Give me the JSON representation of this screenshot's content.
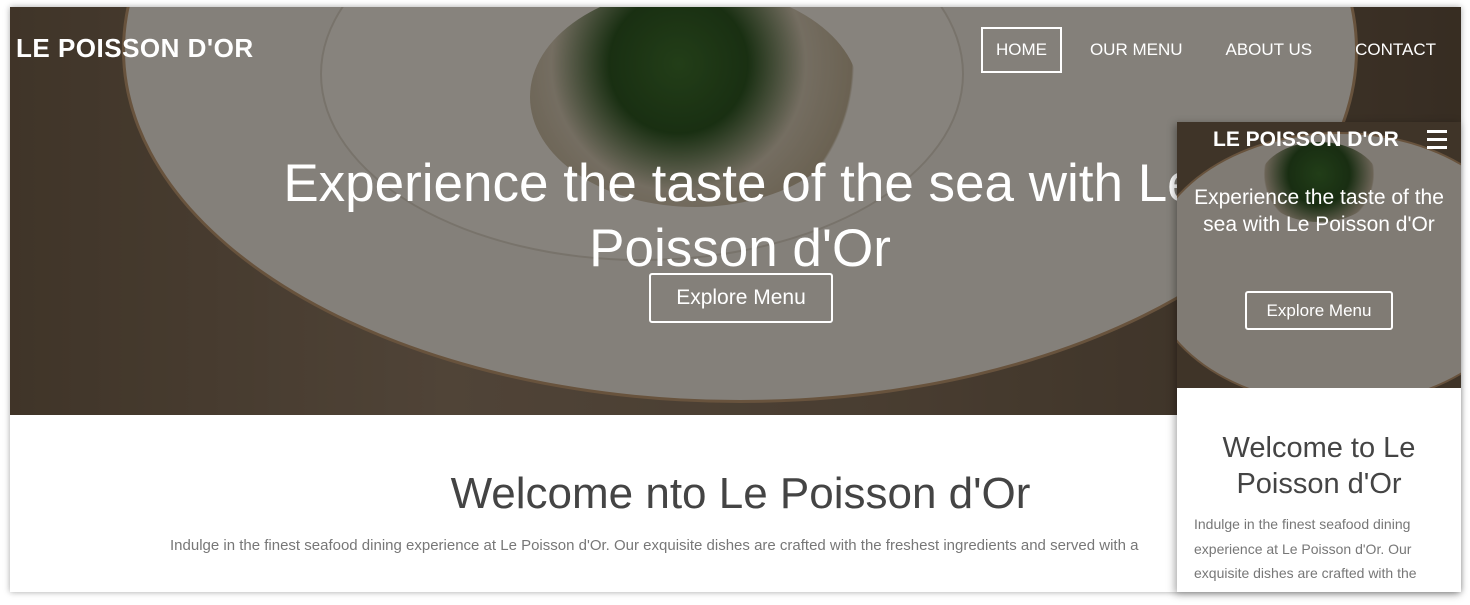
{
  "desktop": {
    "brand": "LE POISSON D'OR",
    "nav": {
      "home": "HOME",
      "menu": "OUR MENU",
      "about": "ABOUT US",
      "contact": "CONTACT"
    },
    "hero": {
      "title": "Experience the taste of the sea with Le Poisson d'Or",
      "button": "Explore Menu"
    },
    "welcome": {
      "title": "Welcome nto Le Poisson d'Or",
      "text": "Indulge in the finest seafood dining experience at Le Poisson d'Or. Our exquisite dishes are crafted with the freshest ingredients and served with a"
    }
  },
  "mobile": {
    "brand": "LE POISSON D'OR",
    "menu_icon": "hamburger-icon",
    "hero": {
      "title": "Experience the taste of the sea with Le Poisson d'Or",
      "button": "Explore Menu"
    },
    "welcome": {
      "title": "Welcome to Le Poisson d'Or",
      "text": "Indulge in the finest seafood dining experience at Le Poisson d'Or. Our exquisite dishes are crafted with the"
    }
  },
  "colors": {
    "overlay": "#000000",
    "heading_text": "#444444",
    "body_text": "#777777",
    "hero_text": "#ffffff"
  }
}
